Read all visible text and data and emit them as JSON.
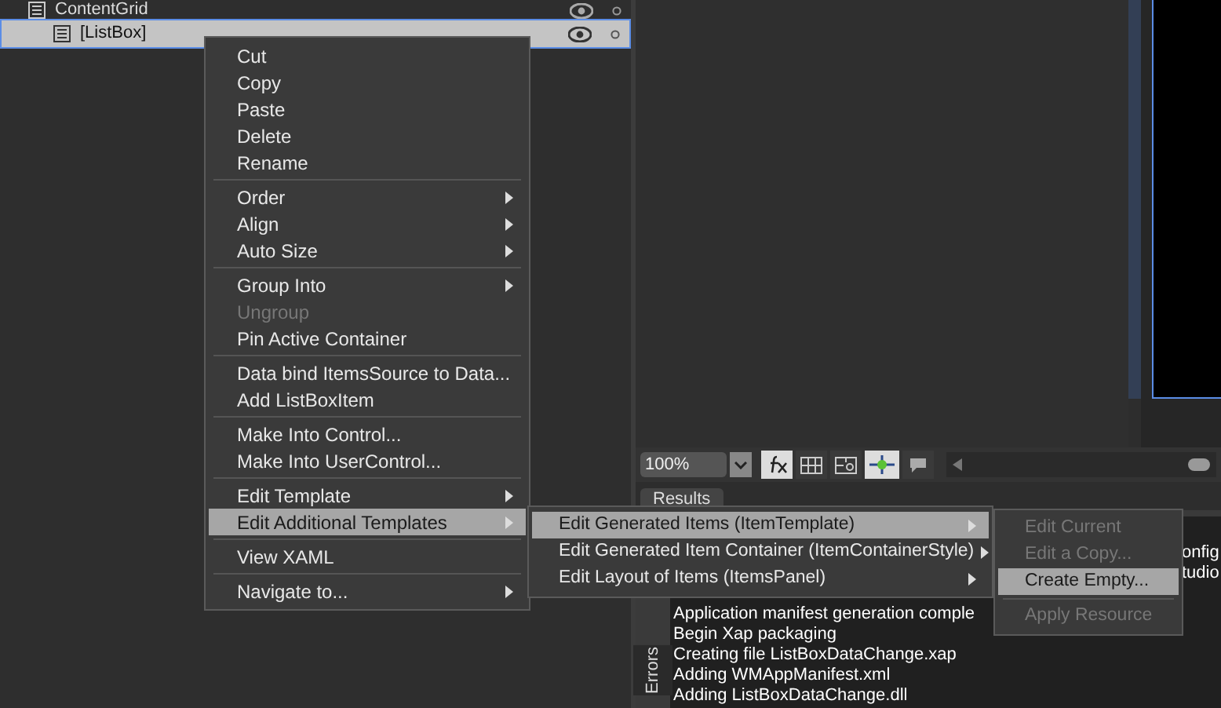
{
  "tree": [
    {
      "label": "ContentGrid",
      "selected": false
    },
    {
      "label": "[ListBox]",
      "selected": true
    }
  ],
  "context_menu": [
    {
      "kind": "item",
      "label": "Cut",
      "disabled": false,
      "selected": false,
      "submenu": false
    },
    {
      "kind": "item",
      "label": "Copy",
      "disabled": false,
      "selected": false,
      "submenu": false
    },
    {
      "kind": "item",
      "label": "Paste",
      "disabled": false,
      "selected": false,
      "submenu": false
    },
    {
      "kind": "item",
      "label": "Delete",
      "disabled": false,
      "selected": false,
      "submenu": false
    },
    {
      "kind": "item",
      "label": "Rename",
      "disabled": false,
      "selected": false,
      "submenu": false
    },
    {
      "kind": "separator"
    },
    {
      "kind": "item",
      "label": "Order",
      "disabled": false,
      "selected": false,
      "submenu": true
    },
    {
      "kind": "item",
      "label": "Align",
      "disabled": false,
      "selected": false,
      "submenu": true
    },
    {
      "kind": "item",
      "label": "Auto Size",
      "disabled": false,
      "selected": false,
      "submenu": true
    },
    {
      "kind": "separator"
    },
    {
      "kind": "item",
      "label": "Group Into",
      "disabled": false,
      "selected": false,
      "submenu": true
    },
    {
      "kind": "item",
      "label": "Ungroup",
      "disabled": true,
      "selected": false,
      "submenu": false
    },
    {
      "kind": "item",
      "label": "Pin Active Container",
      "disabled": false,
      "selected": false,
      "submenu": false
    },
    {
      "kind": "separator"
    },
    {
      "kind": "item",
      "label": "Data bind ItemsSource to Data...",
      "disabled": false,
      "selected": false,
      "submenu": false
    },
    {
      "kind": "item",
      "label": "Add ListBoxItem",
      "disabled": false,
      "selected": false,
      "submenu": false
    },
    {
      "kind": "separator"
    },
    {
      "kind": "item",
      "label": "Make Into Control...",
      "disabled": false,
      "selected": false,
      "submenu": false
    },
    {
      "kind": "item",
      "label": "Make Into UserControl...",
      "disabled": false,
      "selected": false,
      "submenu": false
    },
    {
      "kind": "separator"
    },
    {
      "kind": "item",
      "label": "Edit Template",
      "disabled": false,
      "selected": false,
      "submenu": true
    },
    {
      "kind": "item",
      "label": "Edit Additional Templates",
      "disabled": false,
      "selected": true,
      "submenu": true
    },
    {
      "kind": "separator"
    },
    {
      "kind": "item",
      "label": "View XAML",
      "disabled": false,
      "selected": false,
      "submenu": false
    },
    {
      "kind": "separator"
    },
    {
      "kind": "item",
      "label": "Navigate to...",
      "disabled": false,
      "selected": false,
      "submenu": true
    }
  ],
  "submenu_templates": [
    {
      "kind": "item",
      "label": "Edit Generated Items (ItemTemplate)",
      "disabled": false,
      "selected": true,
      "submenu": true
    },
    {
      "kind": "item",
      "label": "Edit Generated Item Container (ItemContainerStyle)",
      "disabled": false,
      "selected": false,
      "submenu": true
    },
    {
      "kind": "item",
      "label": "Edit Layout of Items (ItemsPanel)",
      "disabled": false,
      "selected": false,
      "submenu": true
    }
  ],
  "submenu_item_template": [
    {
      "kind": "item",
      "label": "Edit Current",
      "disabled": true,
      "selected": false,
      "submenu": false
    },
    {
      "kind": "item",
      "label": "Edit a Copy...",
      "disabled": true,
      "selected": false,
      "submenu": false
    },
    {
      "kind": "item",
      "label": "Create Empty...",
      "disabled": false,
      "selected": true,
      "submenu": false
    },
    {
      "kind": "separator"
    },
    {
      "kind": "item",
      "label": "Apply Resource",
      "disabled": true,
      "selected": false,
      "submenu": false
    }
  ],
  "toolbar": {
    "zoom": "100%",
    "snap_on": true
  },
  "results": {
    "tab": "Results",
    "side_tab": "Errors",
    "lines": [
      {
        "kind": "tail",
        "text": "onfig"
      },
      {
        "kind": "tail",
        "text": "tudio"
      },
      {
        "kind": "full",
        "text": "Application manifest generation comple"
      },
      {
        "kind": "full",
        "text": "Begin Xap packaging"
      },
      {
        "kind": "full",
        "text": "Creating file ListBoxDataChange.xap"
      },
      {
        "kind": "full",
        "text": "Adding WMAppManifest.xml"
      },
      {
        "kind": "full",
        "text": "Adding ListBoxDataChange.dll"
      }
    ]
  }
}
